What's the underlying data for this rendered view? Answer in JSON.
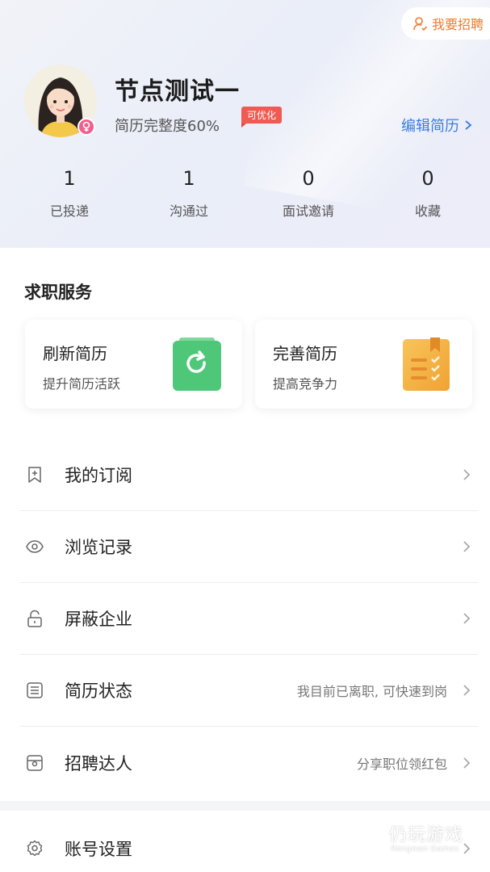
{
  "header": {
    "recruit_button": "我要招聘",
    "username": "节点测试一",
    "resume_completeness": "简历完整度60%",
    "optimize_tag": "可优化",
    "edit_resume": "编辑简历"
  },
  "stats": [
    {
      "value": "1",
      "label": "已投递"
    },
    {
      "value": "1",
      "label": "沟通过"
    },
    {
      "value": "0",
      "label": "面试邀请"
    },
    {
      "value": "0",
      "label": "收藏"
    }
  ],
  "services": {
    "title": "求职服务",
    "cards": [
      {
        "title": "刷新简历",
        "subtitle": "提升简历活跃",
        "icon": "refresh-icon",
        "color": "#4fc779"
      },
      {
        "title": "完善简历",
        "subtitle": "提高竞争力",
        "icon": "document-check-icon",
        "color": "#f5b142"
      }
    ]
  },
  "menu": [
    {
      "label": "我的订阅",
      "value": "",
      "icon": "bookmark-icon"
    },
    {
      "label": "浏览记录",
      "value": "",
      "icon": "eye-icon"
    },
    {
      "label": "屏蔽企业",
      "value": "",
      "icon": "lock-icon"
    },
    {
      "label": "简历状态",
      "value": "我目前已离职, 可快速到岗",
      "icon": "list-icon"
    },
    {
      "label": "招聘达人",
      "value": "分享职位领红包",
      "icon": "wallet-icon"
    },
    {
      "label": "账号设置",
      "value": "",
      "icon": "gear-icon"
    }
  ],
  "watermark": {
    "title": "仍玩游戏",
    "subtitle": "Rengwan Games"
  },
  "colors": {
    "accent_blue": "#3a7de0",
    "accent_orange": "#f07b2e",
    "tag_red": "#ef5b52"
  }
}
